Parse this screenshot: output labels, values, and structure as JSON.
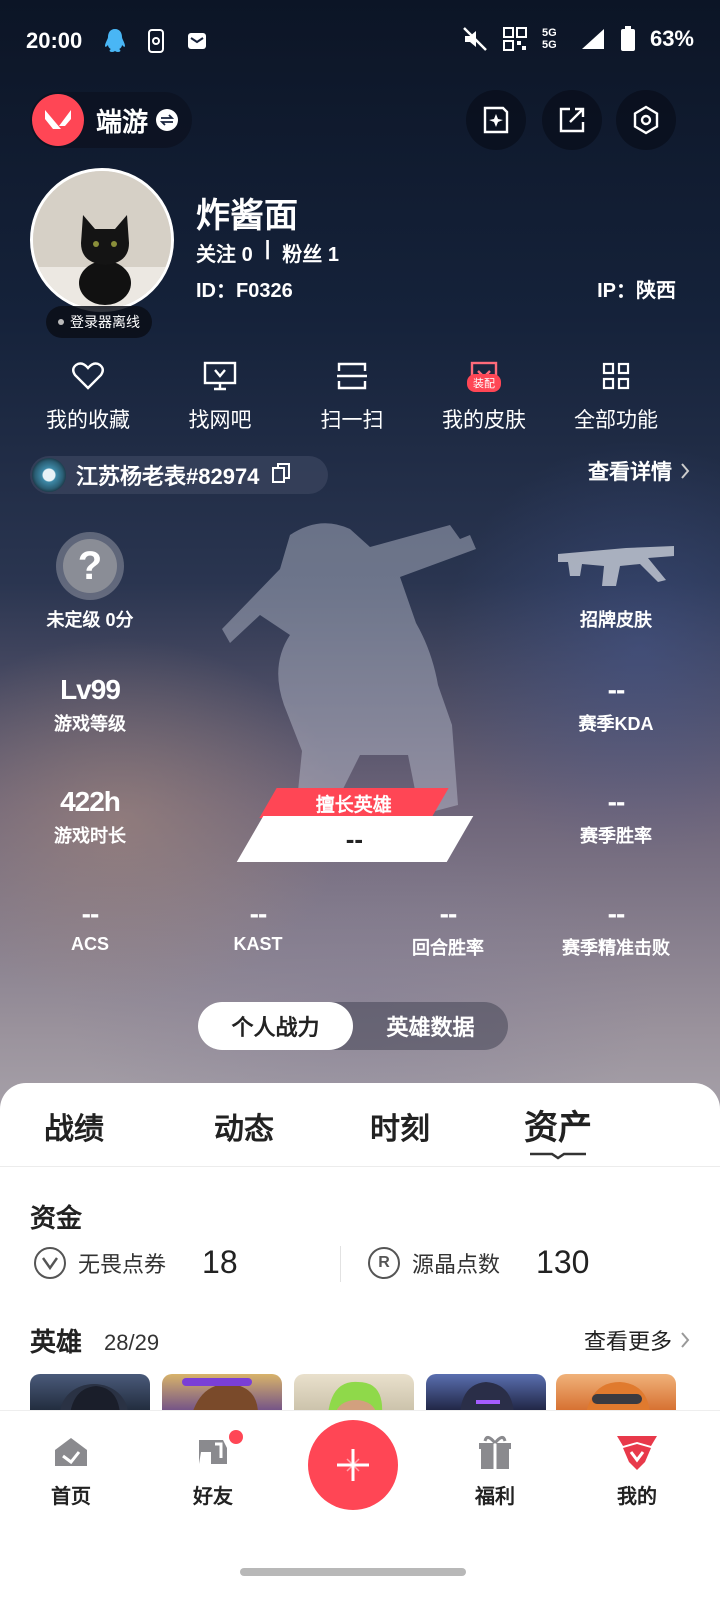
{
  "status_bar": {
    "time": "20:00",
    "network": "5G 5G",
    "battery": "63%"
  },
  "app": {
    "name": "端游"
  },
  "profile": {
    "name": "炸酱面",
    "follow_label": "关注",
    "follow_count": "0",
    "fans_label": "粉丝",
    "fans_count": "1",
    "separator": "|",
    "id": "ID：F0326",
    "ip": "IP：陕西",
    "status": "登录器离线"
  },
  "quick_actions": [
    {
      "label": "我的收藏",
      "icon": "heart-icon"
    },
    {
      "label": "找网吧",
      "icon": "monitor-icon"
    },
    {
      "label": "扫一扫",
      "icon": "scan-icon"
    },
    {
      "label": "我的皮肤",
      "icon": "skin-icon",
      "badge": "装配"
    },
    {
      "label": "全部功能",
      "icon": "grid-icon"
    }
  ],
  "riot_id": "江苏杨老表#82974",
  "view_detail": "查看详情",
  "stats": {
    "rank": {
      "label": "未定级 0分",
      "icon_glyph": "?"
    },
    "signature_skin": {
      "label": "招牌皮肤"
    },
    "level": {
      "value": "Lv99",
      "label": "游戏等级"
    },
    "playtime": {
      "value": "422h",
      "label": "游戏时长"
    },
    "kda": {
      "value": "--",
      "label": "赛季KDA"
    },
    "winrate": {
      "value": "--",
      "label": "赛季胜率"
    },
    "best_hero": {
      "label": "擅长英雄",
      "value": "--"
    },
    "bottom": [
      {
        "value": "--",
        "label": "ACS"
      },
      {
        "value": "--",
        "label": "KAST"
      },
      {
        "value": "--",
        "label": "回合胜率"
      },
      {
        "value": "--",
        "label": "赛季精准击败"
      }
    ]
  },
  "toggle": {
    "left": "个人战力",
    "right": "英雄数据"
  },
  "tabs": [
    "战绩",
    "动态",
    "时刻",
    "资产"
  ],
  "assets": {
    "funds_title": "资金",
    "vp_label": "无畏点券",
    "vp_value": "18",
    "radianite_label": "源晶点数",
    "radianite_value": "130",
    "heroes_title": "英雄",
    "heroes_count": "28/29",
    "view_more": "查看更多"
  },
  "bottom_nav": [
    {
      "label": "首页",
      "icon": "home-icon"
    },
    {
      "label": "好友",
      "icon": "friends-icon"
    },
    {
      "label": "福利",
      "icon": "gift-icon"
    },
    {
      "label": "我的",
      "icon": "me-icon"
    }
  ],
  "colors": {
    "accent": "#ff4655",
    "text_dark": "#222222"
  }
}
